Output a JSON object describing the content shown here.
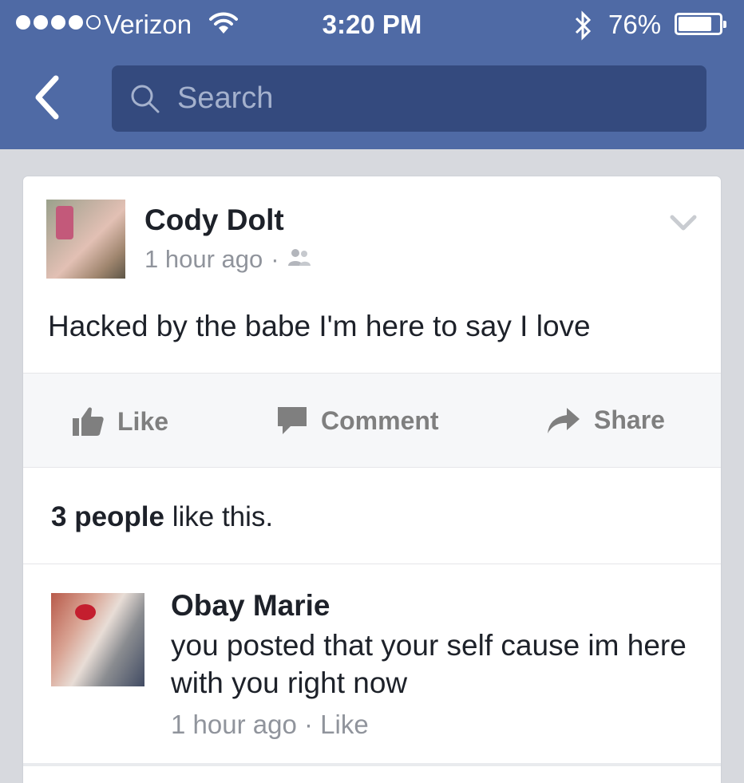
{
  "status_bar": {
    "carrier": "Verizon",
    "time": "3:20 PM",
    "battery_percent": "76%",
    "battery_level": 0.76,
    "signal_bars": 4,
    "signal_total": 5,
    "icons": [
      "wifi-icon",
      "bluetooth-icon",
      "battery-icon"
    ]
  },
  "nav": {
    "back_icon": "chevron-left-icon",
    "search_placeholder": "Search",
    "search_icon": "search-icon"
  },
  "colors": {
    "header_blue": "#4f6aa5",
    "search_field": "#344a7e",
    "background": "#d7d9de",
    "meta_gray": "#90949c",
    "action_gray": "#7f7f7f"
  },
  "post": {
    "author": "Cody Dolt",
    "time": "1 hour ago",
    "separator": "·",
    "audience_icon": "friends-icon",
    "options_icon": "chevron-down-icon",
    "text": "Hacked by the babe I'm here to say I love"
  },
  "actions": {
    "like_label": "Like",
    "comment_label": "Comment",
    "share_label": "Share"
  },
  "likes": {
    "count_text": "3 people",
    "suffix_text": " like this."
  },
  "comment": {
    "author": "Obay Marie",
    "text": "you posted that your self cause im here with you right now",
    "time": "1 hour ago",
    "separator": " · ",
    "like_label": "Like"
  }
}
